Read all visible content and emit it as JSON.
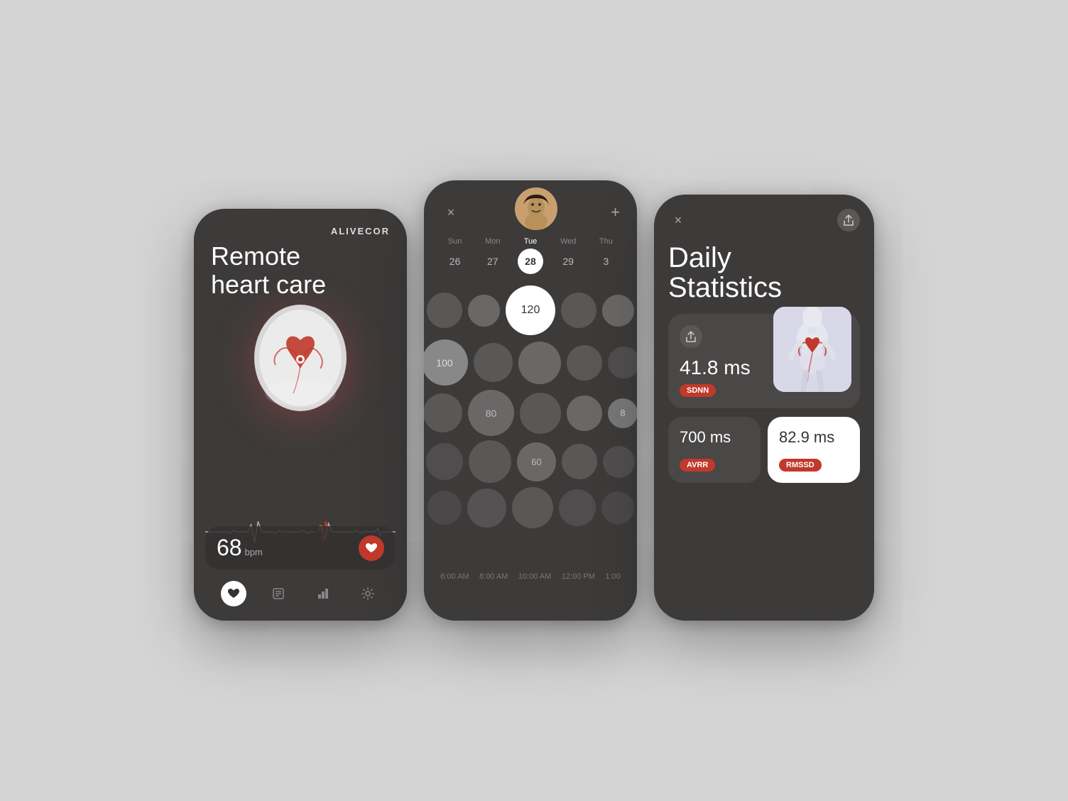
{
  "phone1": {
    "brand": "ALIVECOR",
    "title_line1": "Remote",
    "title_line2": "heart care",
    "bpm": "68",
    "bpm_unit": "bpm",
    "nav_items": [
      {
        "icon": "❤️",
        "active": true,
        "name": "heart-nav"
      },
      {
        "icon": "📋",
        "active": false,
        "name": "notes-nav"
      },
      {
        "icon": "📊",
        "active": false,
        "name": "stats-nav"
      },
      {
        "icon": "⚙️",
        "active": false,
        "name": "settings-nav"
      }
    ]
  },
  "phone2": {
    "calendar": [
      {
        "day": "Sun",
        "date": "26",
        "active": false
      },
      {
        "day": "Mon",
        "date": "27",
        "active": false
      },
      {
        "day": "Tue",
        "date": "28",
        "active": true
      },
      {
        "day": "Wed",
        "date": "29",
        "active": false
      },
      {
        "day": "Thu",
        "date": "3",
        "active": false
      }
    ],
    "time_labels": [
      "6:00 AM",
      "8:00 AM",
      "10:00 AM",
      "12:00 PM",
      "1:00"
    ],
    "bubble_values": [
      "120",
      "100",
      "80",
      "60",
      "8"
    ],
    "close_label": "×",
    "add_label": "+"
  },
  "phone3": {
    "title_line1": "Daily",
    "title_line2": "Statistics",
    "close_label": "×",
    "share_label": "↑",
    "sdnn_value": "41.8 ms",
    "sdnn_label": "SDNN",
    "avrr_value": "700 ms",
    "avrr_label": "AVRR",
    "rmssd_value": "82.9 ms",
    "rmssd_label": "RMSSD",
    "filter_icon": "≡"
  }
}
